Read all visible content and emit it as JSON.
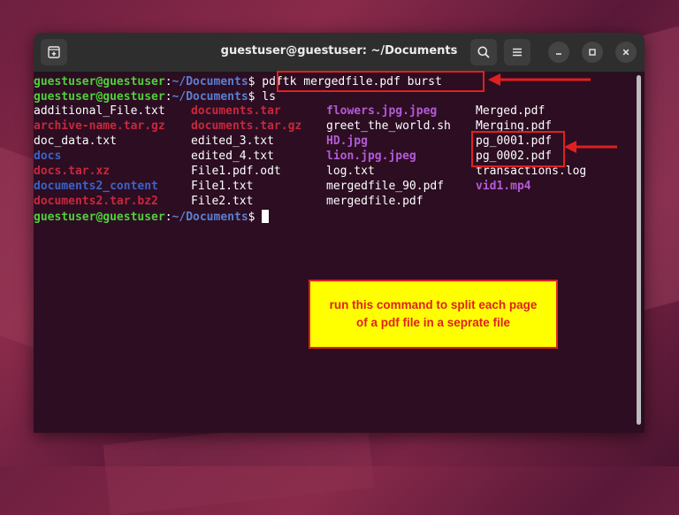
{
  "window": {
    "title": "guestuser@guestuser: ~/Documents"
  },
  "icons": {
    "new_tab": "new-tab-icon",
    "search": "search-icon",
    "menu": "hamburger-menu-icon",
    "minimize": "minimize-icon",
    "maximize": "maximize-icon",
    "close": "close-icon"
  },
  "prompt": {
    "user": "guestuser@guestuser",
    "sep": ":",
    "path": "~/Documents",
    "sign": "$"
  },
  "commands": {
    "cmd1": "pdftk mergedfile.pdf burst",
    "cmd2": "ls"
  },
  "ls": {
    "col1": [
      {
        "name": "additional_File.txt",
        "kind": "file"
      },
      {
        "name": "archive-name.tar.gz",
        "kind": "archive"
      },
      {
        "name": "doc_data.txt",
        "kind": "file"
      },
      {
        "name": "docs",
        "kind": "dir"
      },
      {
        "name": "docs.tar.xz",
        "kind": "archive"
      },
      {
        "name": "documents2_content",
        "kind": "dir"
      },
      {
        "name": "documents2.tar.bz2",
        "kind": "archive"
      }
    ],
    "col2": [
      {
        "name": "documents.tar",
        "kind": "archive"
      },
      {
        "name": "documents.tar.gz",
        "kind": "archive"
      },
      {
        "name": "edited_3.txt",
        "kind": "file"
      },
      {
        "name": "edited_4.txt",
        "kind": "file"
      },
      {
        "name": "File1.pdf.odt",
        "kind": "file"
      },
      {
        "name": "File1.txt",
        "kind": "file"
      },
      {
        "name": "File2.txt",
        "kind": "file"
      }
    ],
    "col3": [
      {
        "name": "flowers.jpg.jpeg",
        "kind": "media"
      },
      {
        "name": "greet_the_world.sh",
        "kind": "file"
      },
      {
        "name": "HD.jpg",
        "kind": "media"
      },
      {
        "name": "lion.jpg.jpeg",
        "kind": "media"
      },
      {
        "name": "log.txt",
        "kind": "file"
      },
      {
        "name": "mergedfile_90.pdf",
        "kind": "file"
      },
      {
        "name": "mergedfile.pdf",
        "kind": "file"
      }
    ],
    "col4": [
      {
        "name": "Merged.pdf",
        "kind": "file"
      },
      {
        "name": "Merging.pdf",
        "kind": "file"
      },
      {
        "name": "pg_0001.pdf",
        "kind": "file"
      },
      {
        "name": "pg_0002.pdf",
        "kind": "file"
      },
      {
        "name": "transactions.log",
        "kind": "file"
      },
      {
        "name": "vid1.mp4",
        "kind": "media"
      }
    ]
  },
  "colors": {
    "user": "#4fd03a",
    "path": "#5b7fd0",
    "archive": "#c8283c",
    "dir": "#3a63c7",
    "media": "#b45ad6",
    "annotation": "#e02020",
    "note_bg": "#ffff00"
  },
  "annotation": {
    "line1": "run this command to split each page",
    "line2": "of a pdf file in a seprate file"
  }
}
